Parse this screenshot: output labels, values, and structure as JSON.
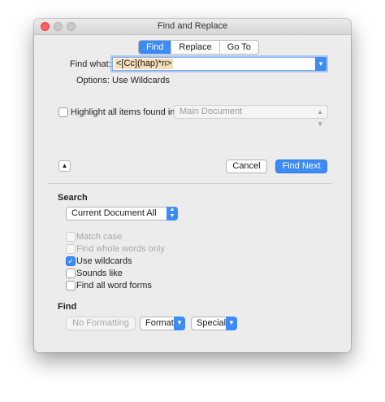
{
  "window": {
    "title": "Find and Replace",
    "controls": [
      "close",
      "minimize",
      "maximize"
    ]
  },
  "tabs": [
    {
      "label": "Find",
      "active": true
    },
    {
      "label": "Replace",
      "active": false
    },
    {
      "label": "Go To",
      "active": false
    }
  ],
  "find_what": {
    "label": "Find what:",
    "value": "<[Cc](hap)*n>"
  },
  "options": {
    "label": "Options:",
    "value": "Use Wildcards"
  },
  "highlight": {
    "label": "Highlight all items found in:",
    "checked": false,
    "popup_value": "Main Document"
  },
  "buttons": {
    "cancel": "Cancel",
    "find_next": "Find Next"
  },
  "search": {
    "heading": "Search",
    "scope_value": "Current Document All"
  },
  "checkboxes": [
    {
      "label": "Match case",
      "checked": false,
      "enabled": false
    },
    {
      "label": "Find whole words only",
      "checked": false,
      "enabled": false
    },
    {
      "label": "Use wildcards",
      "checked": true,
      "enabled": true
    },
    {
      "label": "Sounds like",
      "checked": false,
      "enabled": true
    },
    {
      "label": "Find all word forms",
      "checked": false,
      "enabled": true
    }
  ],
  "find_section": {
    "heading": "Find",
    "no_formatting": "No Formatting",
    "format": "Format",
    "special": "Special"
  },
  "colors": {
    "accent": "#3d8bf5",
    "highlight": "#f5dfb8"
  }
}
